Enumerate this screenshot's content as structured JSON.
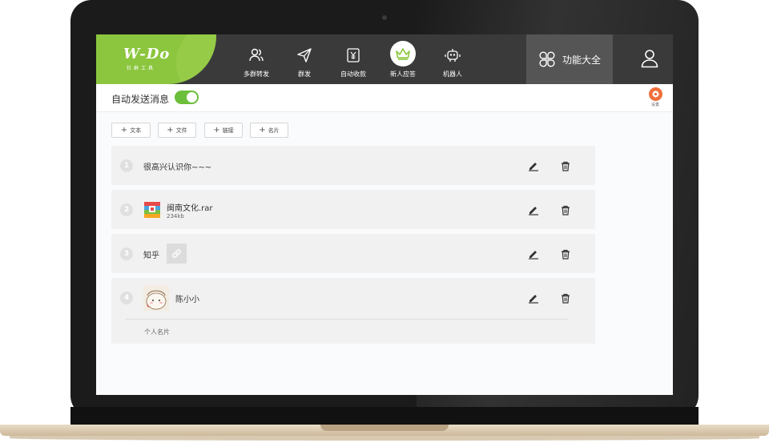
{
  "logo": {
    "main": "W-Do",
    "sub": "社群工具"
  },
  "nav": [
    {
      "label": "多群转发",
      "icon": "users-icon"
    },
    {
      "label": "群发",
      "icon": "send-icon"
    },
    {
      "label": "自动收款",
      "icon": "payment-icon"
    },
    {
      "label": "新人应答",
      "icon": "crown-icon"
    },
    {
      "label": "机器人",
      "icon": "robot-icon"
    }
  ],
  "function_all": {
    "label": "功能大全",
    "icon": "clover-icon"
  },
  "auto_send": {
    "label": "自动发送消息",
    "enabled": true
  },
  "settings": {
    "label": "设置",
    "icon": "gear-icon"
  },
  "add_buttons": [
    {
      "label": "文本"
    },
    {
      "label": "文件"
    },
    {
      "label": "链接"
    },
    {
      "label": "名片"
    }
  ],
  "items": [
    {
      "index": "1",
      "text": "很高兴认识你~~~"
    },
    {
      "index": "2",
      "name": "闽南文化.rar",
      "size": "234kb"
    },
    {
      "index": "3",
      "text": "知乎"
    },
    {
      "index": "4",
      "name": "陈小小",
      "caption": "个人名片"
    }
  ],
  "colors": {
    "accent": "#8cc63f",
    "toggle": "#6cbf3b",
    "settings": "#f06f3a",
    "topbar": "#3a3a3a"
  }
}
